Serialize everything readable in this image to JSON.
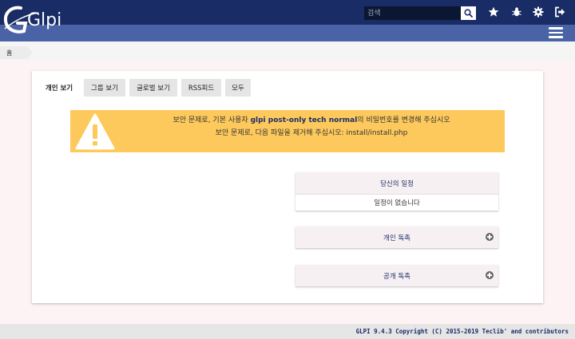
{
  "app": {
    "logo_text": "Glpi",
    "colors": {
      "header_dark": "#1a2c66",
      "header_light": "#4a63a6",
      "alert": "#fec95c",
      "page_bg": "#fdf3f5"
    }
  },
  "header": {
    "search": {
      "placeholder": "검색",
      "icon": "search-icon"
    },
    "icons": [
      "star-icon",
      "bug-icon",
      "gear-icon",
      "logout-icon"
    ],
    "menu_icon": "hamburger-icon"
  },
  "breadcrumb": {
    "home_label": "홈"
  },
  "tabs": [
    {
      "label": "개인 보기",
      "active": true
    },
    {
      "label": "그룹 보기",
      "active": false
    },
    {
      "label": "글로벌 보기",
      "active": false
    },
    {
      "label": "RSS피드",
      "active": false
    },
    {
      "label": "모두",
      "active": false
    }
  ],
  "alert": {
    "icon": "warning-icon",
    "line1_prefix": "보안 문제로, 기본 사용자 ",
    "line1_users": "glpi post-only tech normal",
    "line1_suffix": "의 비밀번호를 변경해 주십시오",
    "line2": "보안 문제로, 다음 파일을 제거해 주십시오: install/install.php"
  },
  "panels": {
    "schedule": {
      "title": "당신의 일정",
      "empty": "일정이 없습니다"
    },
    "personal_notes": {
      "title": "개인 독촉"
    },
    "public_notes": {
      "title": "공개 독촉"
    }
  },
  "footer": {
    "text": "GLPI 9.4.3 Copyright (C) 2015-2019 Teclib' and contributors"
  }
}
